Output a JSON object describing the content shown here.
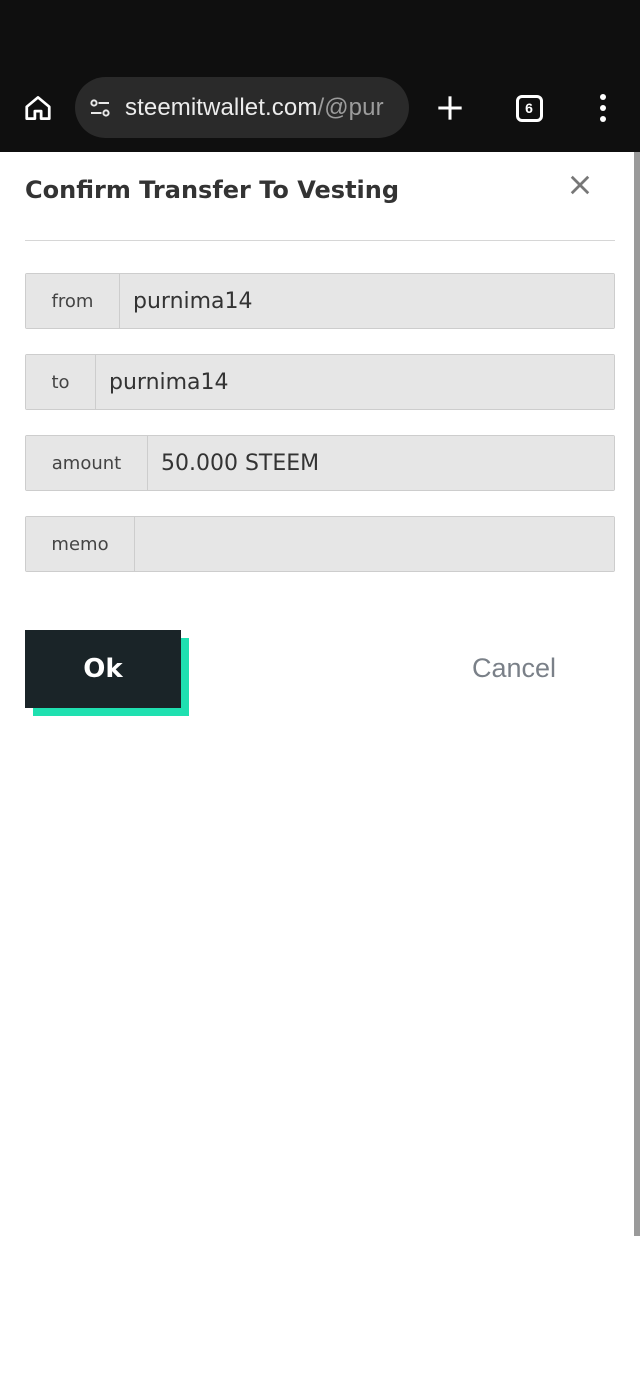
{
  "browser": {
    "url_host": "steemitwallet.com",
    "url_path": "/@pur",
    "tab_count": "6"
  },
  "dialog": {
    "title": "Confirm Transfer To Vesting",
    "fields": [
      {
        "label": "from",
        "value": "purnima14"
      },
      {
        "label": "to",
        "value": "purnima14"
      },
      {
        "label": "amount",
        "value": "50.000 STEEM"
      },
      {
        "label": "memo",
        "value": ""
      }
    ],
    "ok_label": "Ok",
    "cancel_label": "Cancel"
  },
  "colors": {
    "ok_button_bg": "#1a2428",
    "ok_button_accent": "#1fe0b0",
    "browser_bar": "#0f0f0f"
  },
  "icons": [
    "home-icon",
    "site-settings-icon",
    "plus-icon",
    "tabs-icon",
    "more-vert-icon",
    "close-icon"
  ]
}
